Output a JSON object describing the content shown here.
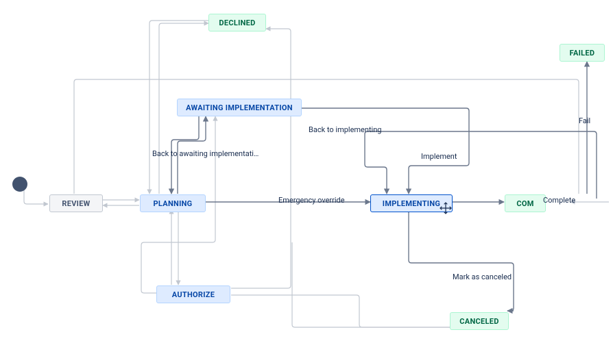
{
  "diagram": {
    "type": "workflow",
    "nodes": {
      "review": {
        "label": "REVIEW",
        "style": "gray"
      },
      "planning": {
        "label": "PLANNING",
        "style": "blue"
      },
      "authorize": {
        "label": "AUTHORIZE",
        "style": "blue"
      },
      "awaiting_impl": {
        "label": "AWAITING IMPLEMENTATION",
        "style": "blue"
      },
      "declined": {
        "label": "DECLINED",
        "style": "green"
      },
      "implementing": {
        "label": "IMPLEMENTING",
        "style": "blue-sel"
      },
      "completed": {
        "label": "COM",
        "style": "green"
      },
      "canceled": {
        "label": "CANCELED",
        "style": "green"
      },
      "failed": {
        "label": "FAILED",
        "style": "green"
      }
    },
    "transitions": {
      "back_to_awaiting": {
        "label": "Back to awaiting implementati…"
      },
      "emergency_override": {
        "label": "Emergency override"
      },
      "back_to_implement": {
        "label": "Back to implementing"
      },
      "implement": {
        "label": "Implement"
      },
      "complete": {
        "label": "Complete"
      },
      "mark_canceled": {
        "label": "Mark as canceled"
      },
      "fail": {
        "label": "Fail"
      }
    }
  }
}
